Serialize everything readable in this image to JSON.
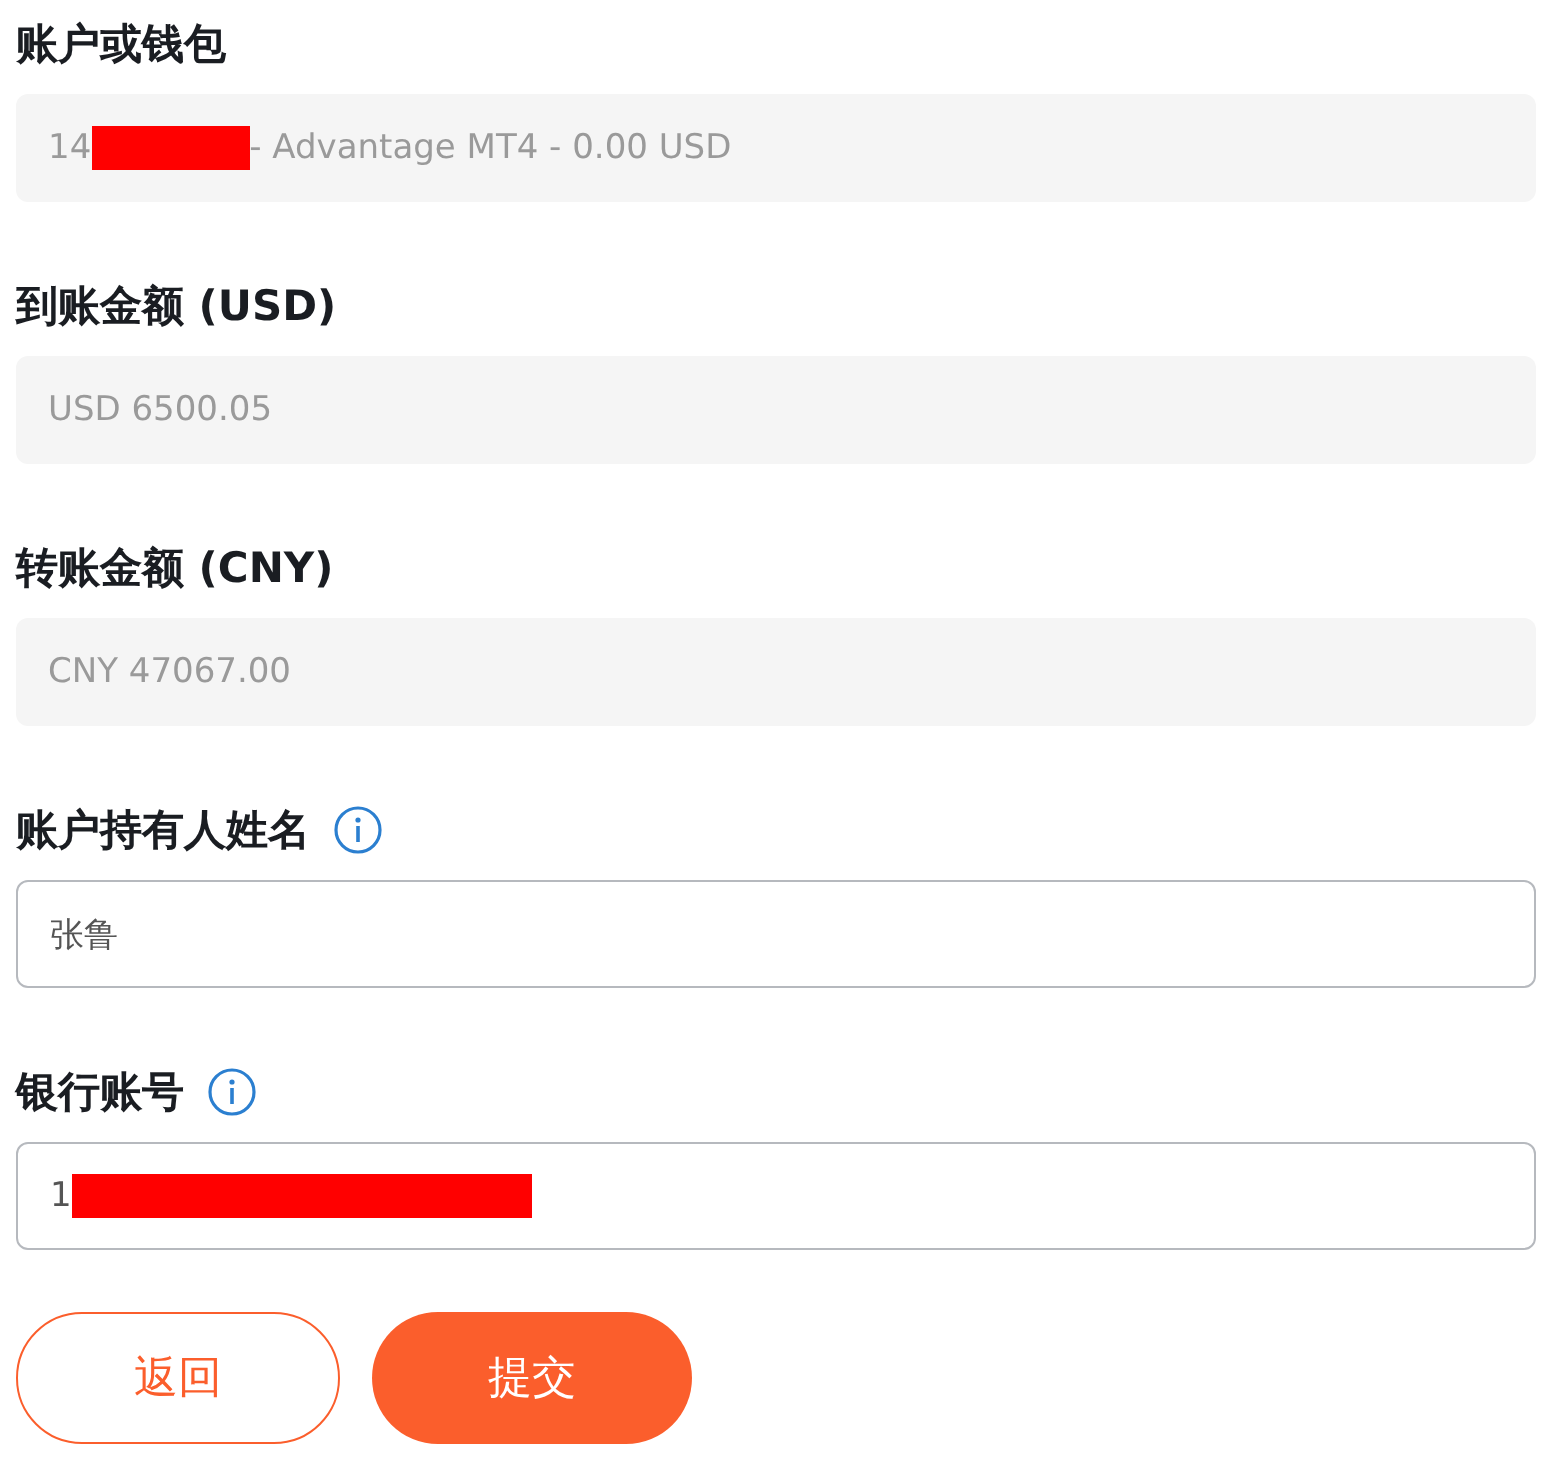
{
  "fields": [
    {
      "label": "账户或钱包",
      "info": false,
      "kind": "readonly",
      "value_parts": [
        {
          "kind": "text",
          "text": "14"
        },
        {
          "kind": "redaction"
        },
        {
          "kind": "text",
          "text": "- Advantage MT4 - 0.00 USD"
        }
      ]
    },
    {
      "label": "到账金额 (USD)",
      "info": false,
      "kind": "readonly",
      "value_parts": [
        {
          "kind": "text",
          "text": "USD 6500.05"
        }
      ]
    },
    {
      "label": "转账金额 (CNY)",
      "info": false,
      "kind": "readonly",
      "value_parts": [
        {
          "kind": "text",
          "text": "CNY 47067.00"
        }
      ]
    },
    {
      "label": "账户持有人姓名",
      "info": true,
      "kind": "input",
      "value_parts": [
        {
          "kind": "text",
          "text": "张鲁"
        }
      ]
    },
    {
      "label": "银行账号",
      "info": true,
      "kind": "input",
      "value_parts": [
        {
          "kind": "text",
          "text": "1"
        },
        {
          "kind": "redaction"
        }
      ]
    }
  ],
  "buttons": [
    {
      "label": "返回",
      "kind": "secondary"
    },
    {
      "label": "提交",
      "kind": "primary"
    }
  ]
}
